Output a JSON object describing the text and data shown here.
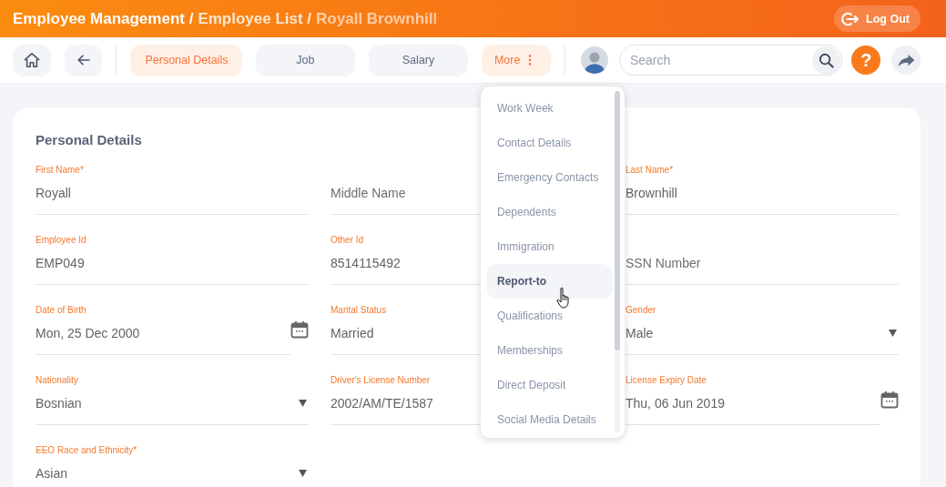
{
  "header": {
    "breadcrumb": [
      "Employee Management /",
      "Employee List /",
      "Royall Brownhill"
    ],
    "logout_button": "Log Out"
  },
  "toolbar": {
    "tabs": [
      {
        "label": "Personal Details",
        "selected": true
      },
      {
        "label": "Job",
        "selected": false
      },
      {
        "label": "Salary",
        "selected": false
      }
    ],
    "more_button": {
      "label": "More",
      "open": true
    },
    "search": {
      "placeholder": "Search"
    },
    "help_button": "?"
  },
  "more_menu": {
    "items": [
      {
        "label": "Work Week",
        "highlighted": false
      },
      {
        "label": "Contact Details",
        "highlighted": false
      },
      {
        "label": "Emergency Contacts",
        "highlighted": false
      },
      {
        "label": "Dependents",
        "highlighted": false
      },
      {
        "label": "Immigration",
        "highlighted": false
      },
      {
        "label": "Report-to",
        "highlighted": true
      },
      {
        "label": "Qualifications",
        "highlighted": false
      },
      {
        "label": "Memberships",
        "highlighted": false
      },
      {
        "label": "Direct Deposit",
        "highlighted": false
      },
      {
        "label": "Social Media Details",
        "highlighted": false
      }
    ]
  },
  "card": {
    "title": "Personal Details",
    "fields": [
      {
        "kind": "text",
        "label": "First Name*",
        "value": "Royall"
      },
      {
        "kind": "text",
        "label": "Middle Name"
      },
      {
        "kind": "text",
        "label": "Last Name*",
        "value": "Brownhill"
      },
      {
        "kind": "text",
        "label": "Employee Id",
        "value": "EMP049"
      },
      {
        "kind": "text",
        "label": "Other Id",
        "value": "8514115492"
      },
      {
        "kind": "text",
        "label": "SSN Number"
      },
      {
        "kind": "date",
        "label": "Date of Birth",
        "value": "Mon, 25 Dec 2000"
      },
      {
        "kind": "text",
        "label": "Marital Status",
        "value": "Married"
      },
      {
        "kind": "select",
        "label": "Gender",
        "value": "Male"
      },
      {
        "kind": "select",
        "label": "Nationality",
        "value": "Bosnian"
      },
      {
        "kind": "text",
        "label": "Driver's License Number",
        "value": "2002/AM/TE/1587"
      },
      {
        "kind": "date",
        "label": "License Expiry Date",
        "value": "Thu, 06 Jun 2019"
      },
      {
        "kind": "select",
        "label": "EEO Race and Ethnicity*",
        "value": "Asian"
      }
    ]
  }
}
